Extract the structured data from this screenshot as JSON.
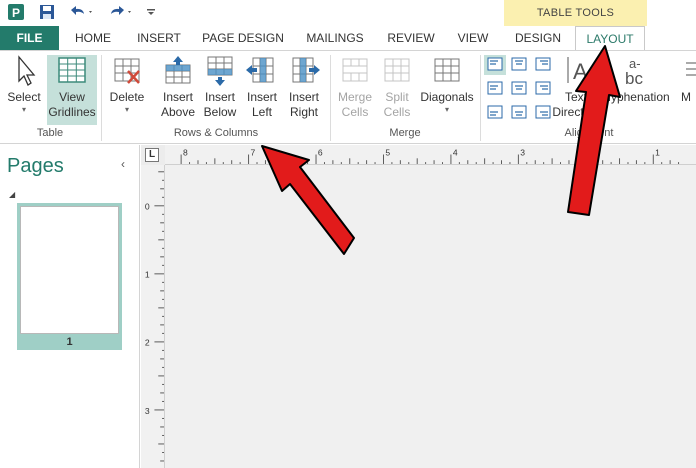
{
  "qat": {
    "app_icon": "publisher-icon",
    "icons": [
      "save-icon",
      "undo-icon",
      "redo-icon",
      "customize-qat-icon"
    ]
  },
  "contextual": {
    "header": "TABLE TOOLS"
  },
  "tabs": {
    "file": "FILE",
    "home": "HOME",
    "insert": "INSERT",
    "page_design": "PAGE DESIGN",
    "mailings": "MAILINGS",
    "review": "REVIEW",
    "view": "VIEW",
    "design": "DESIGN",
    "layout": "LAYOUT"
  },
  "ribbon": {
    "table_group": {
      "label": "Table",
      "select": "Select",
      "view_gridlines_1": "View",
      "view_gridlines_2": "Gridlines"
    },
    "rows_columns_group": {
      "label": "Rows & Columns",
      "delete": "Delete",
      "insert_above_1": "Insert",
      "insert_above_2": "Above",
      "insert_below_1": "Insert",
      "insert_below_2": "Below",
      "insert_left_1": "Insert",
      "insert_left_2": "Left",
      "insert_right_1": "Insert",
      "insert_right_2": "Right"
    },
    "merge_group": {
      "label": "Merge",
      "merge_cells_1": "Merge",
      "merge_cells_2": "Cells",
      "split_cells_1": "Split",
      "split_cells_2": "Cells",
      "diagonals": "Diagonals"
    },
    "alignment_group": {
      "label": "Alignment",
      "text_direction_1": "Text",
      "text_direction_2": "Direction",
      "hyphenation": "Hyphenation",
      "margins_partial": "M"
    }
  },
  "pages_panel": {
    "title": "Pages",
    "page_number": "1"
  },
  "ruler": {
    "corner": "L",
    "h_labels": [
      "8",
      "7",
      "6",
      "5",
      "4",
      "3",
      "2",
      "1"
    ],
    "v_labels": [
      "0",
      "1",
      "2",
      "3"
    ]
  },
  "colors": {
    "accent": "#237b6b",
    "contextual": "#fbf0b0",
    "arrow": "#e21b1b"
  }
}
